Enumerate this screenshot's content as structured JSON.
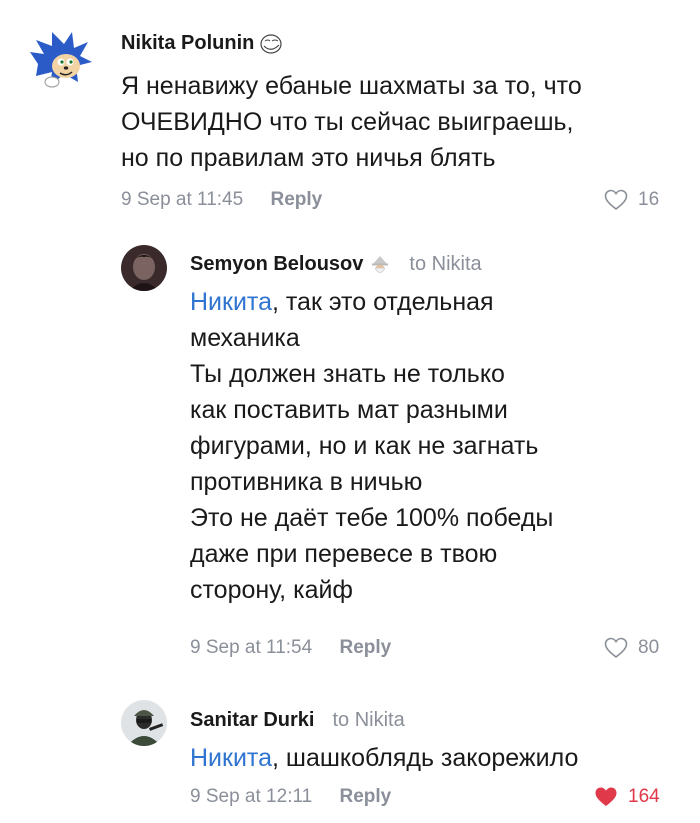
{
  "comments": [
    {
      "author": "Nikita Polunin",
      "reply_to": "",
      "text_lines": [
        "Я ненавижу ебаные шахматы за то, что",
        "ОЧЕВИДНО что ты сейчас выиграешь,",
        "но по правилам это ничья блять"
      ],
      "time": "9 Sep at 11:45",
      "reply_label": "Reply",
      "likes": "16",
      "liked": false
    },
    {
      "author": "Semyon Belousov",
      "reply_to": "to Nikita",
      "mention": "Никита",
      "first_line_rest": ", так это отдельная",
      "text_lines": [
        "механика",
        "Ты должен знать не только",
        "как поставить мат разными",
        "фигурами, но и как не загнать",
        "противника в ничью",
        "Это не даёт тебе 100% победы",
        "даже при перевесе в твою",
        "сторону, кайф"
      ],
      "time": "9 Sep at 11:54",
      "reply_label": "Reply",
      "likes": "80",
      "liked": false
    },
    {
      "author": "Sanitar Durki",
      "reply_to": "to Nikita",
      "mention": "Никита",
      "first_line_rest": ", шашкоблядь закорежило",
      "time": "9 Sep at 12:11",
      "reply_label": "Reply",
      "likes": "164",
      "liked": true
    }
  ],
  "colors": {
    "mention": "#2f74d0",
    "meta": "#8a8f99",
    "liked": "#e0394a"
  },
  "icons": [
    "sonic-avatar",
    "troll-face-icon",
    "avatar-photo",
    "gnome-icon",
    "avatar-soldier",
    "heart-outline-icon",
    "heart-filled-icon"
  ]
}
